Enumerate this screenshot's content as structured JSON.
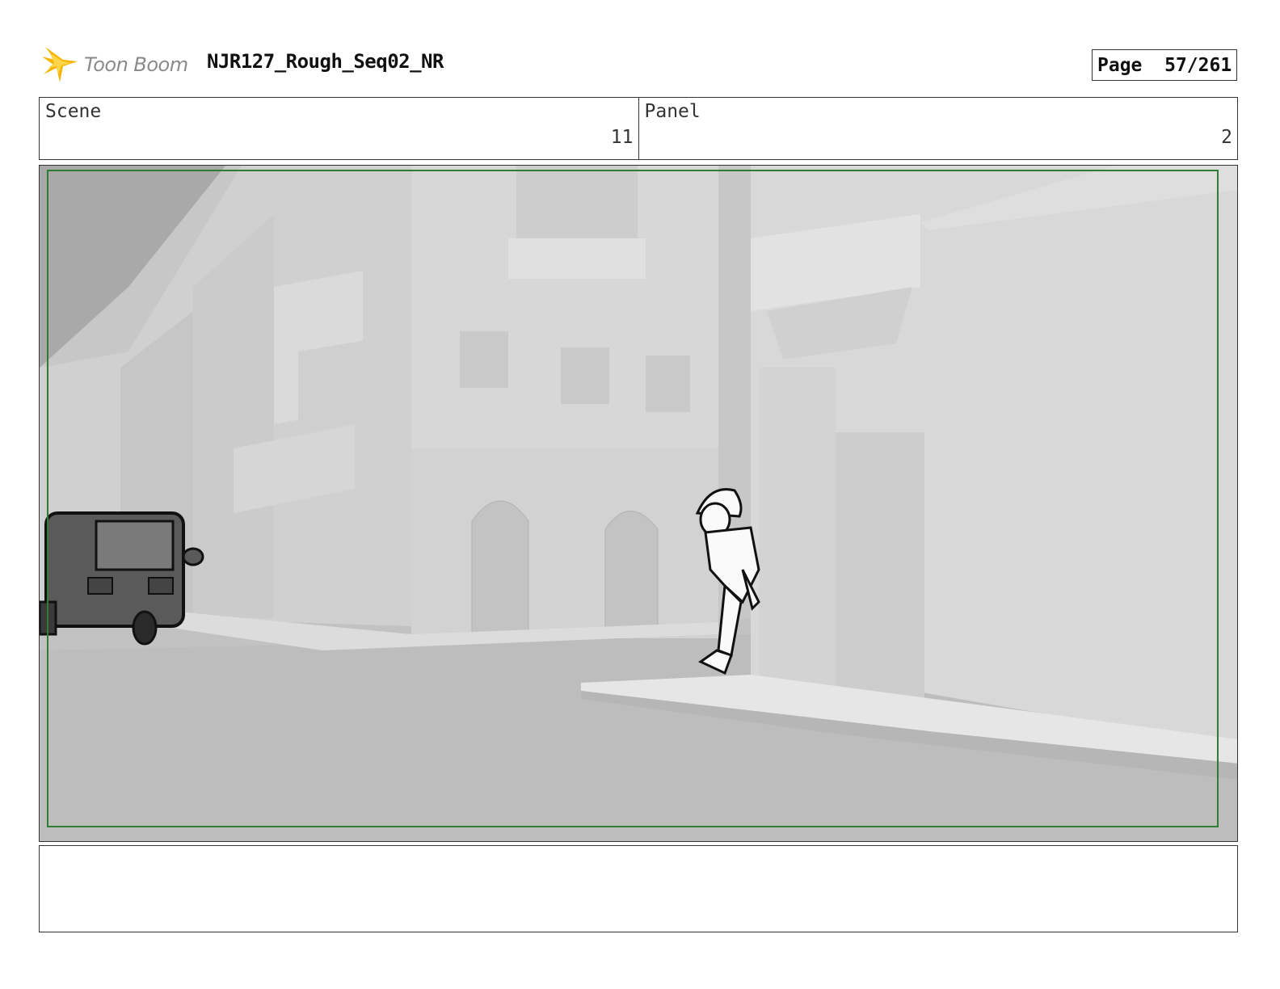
{
  "header": {
    "logo_text": "Toon Boom",
    "title": "NJR127_Rough_Seq02_NR",
    "page_label": "Page",
    "page_value": "57/261"
  },
  "info": {
    "scene_label": "Scene",
    "scene_value": "11",
    "panel_label": "Panel",
    "panel_value": "2"
  },
  "panel_image": {
    "icon": "storyboard-panel-street-scene",
    "safe_frame_color": "#2e7d32"
  },
  "notes": {
    "text": ""
  }
}
